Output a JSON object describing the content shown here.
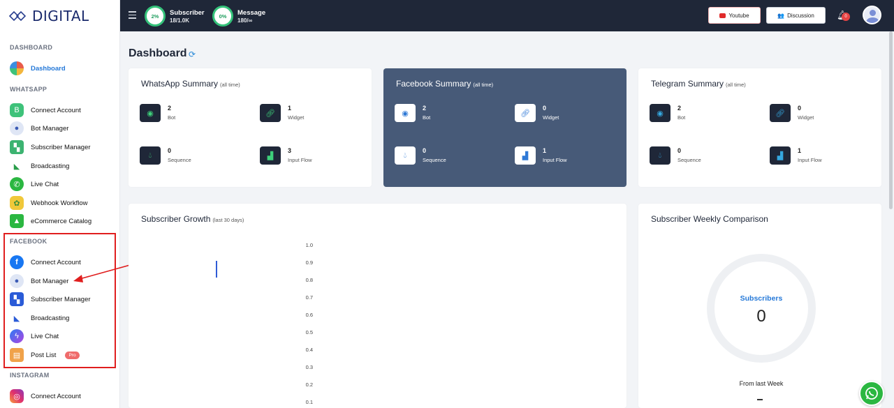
{
  "brand": {
    "name": "DIGITAL"
  },
  "sidebar": {
    "sections": {
      "dashboard": "DASHBOARD",
      "whatsapp": "WHATSAPP",
      "facebook": "FACEBOOK",
      "instagram": "INSTAGRAM"
    },
    "dashboard_item": "Dashboard",
    "whatsapp_items": [
      "Connect Account",
      "Bot Manager",
      "Subscriber Manager",
      "Broadcasting",
      "Live Chat",
      "Webhook Workflow",
      "eCommerce Catalog"
    ],
    "facebook_items": [
      "Connect Account",
      "Bot Manager",
      "Subscriber Manager",
      "Broadcasting",
      "Live Chat",
      "Post List"
    ],
    "pro_badge": "Pro",
    "instagram_items": [
      "Connect Account"
    ]
  },
  "topbar": {
    "subscriber": {
      "percent": "2%",
      "label": "Subscriber",
      "value": "18/1.0K"
    },
    "message": {
      "percent": "0%",
      "label": "Message",
      "value": "180/∞"
    },
    "youtube": "Youtube",
    "discussion": "Discussion",
    "notifications": "0"
  },
  "page": {
    "title": "Dashboard"
  },
  "summaries": [
    {
      "title": "WhatsApp Summary",
      "note": "(all time)",
      "bot": "2",
      "bot_label": "Bot",
      "widget": "1",
      "widget_label": "Widget",
      "sequence": "0",
      "sequence_label": "Sequence",
      "flow": "3",
      "flow_label": "Input Flow"
    },
    {
      "title": "Facebook Summary",
      "note": "(all time)",
      "bot": "2",
      "bot_label": "Bot",
      "widget": "0",
      "widget_label": "Widget",
      "sequence": "0",
      "sequence_label": "Sequence",
      "flow": "1",
      "flow_label": "Input Flow"
    },
    {
      "title": "Telegram Summary",
      "note": "(all time)",
      "bot": "2",
      "bot_label": "Bot",
      "widget": "0",
      "widget_label": "Widget",
      "sequence": "0",
      "sequence_label": "Sequence",
      "flow": "1",
      "flow_label": "Input Flow"
    }
  ],
  "growth": {
    "title": "Subscriber Growth",
    "note": "(last 30 days)",
    "y_ticks": [
      "1.0",
      "0.9",
      "0.8",
      "0.7",
      "0.6",
      "0.5",
      "0.4",
      "0.3",
      "0.2",
      "0.1"
    ]
  },
  "weekly": {
    "title": "Subscriber Weekly Comparison",
    "center_label": "Subscribers",
    "center_value": "0",
    "from_label": "From last Week"
  },
  "colors": {
    "accent": "#2478d8",
    "topbar": "#1f2738",
    "facebook_card": "#475a78",
    "highlight": "#e01e1e"
  }
}
